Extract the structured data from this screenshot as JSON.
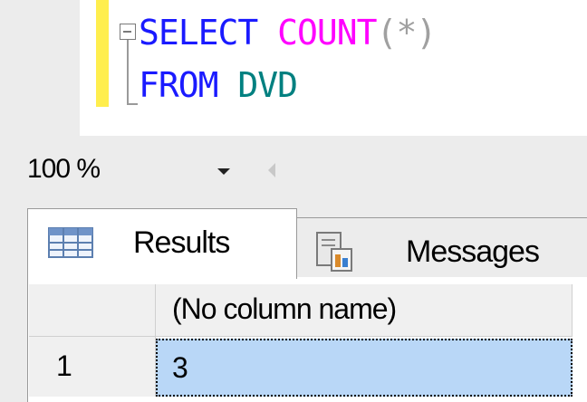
{
  "editor": {
    "line1": {
      "keyword": "SELECT",
      "function": "COUNT",
      "paren_open": "(",
      "star": "*",
      "paren_close": ")"
    },
    "line2": {
      "keyword": "FROM",
      "identifier": "DVD"
    }
  },
  "zoom": {
    "value": "100 %"
  },
  "tabs": [
    {
      "label": "Results",
      "icon": "grid-icon"
    },
    {
      "label": "Messages",
      "icon": "messages-icon"
    }
  ],
  "grid": {
    "column_header": "(No column name)",
    "rows": [
      {
        "row_number": "1",
        "value": "3"
      }
    ]
  },
  "colors": {
    "keyword": "#1a1aff",
    "function": "#ff00ff",
    "identifier": "#008080",
    "selection": "#b9d7f7",
    "change_marker": "#ffee4d"
  }
}
